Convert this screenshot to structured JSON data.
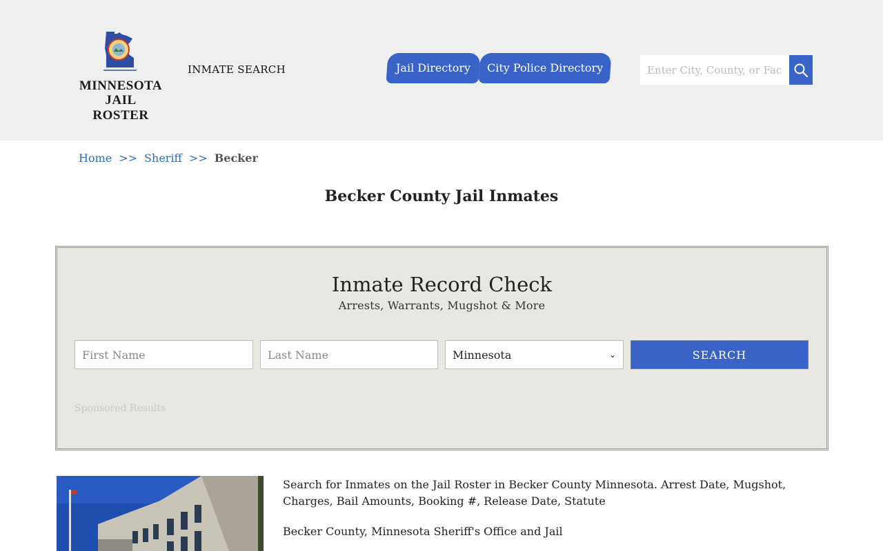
{
  "header": {
    "logo_line1": "MINNESOTA",
    "logo_line2": "JAIL ROSTER",
    "inmate_search_link": "INMATE SEARCH",
    "nav": [
      {
        "label": "Jail Directory"
      },
      {
        "label": "City Police Directory"
      }
    ],
    "search_placeholder": "Enter City, County, or Facility",
    "accent_color": "#3a63c7"
  },
  "breadcrumb": {
    "home": "Home",
    "sep": ">>",
    "sheriff": "Sheriff",
    "current": "Becker"
  },
  "page_title": "Becker County Jail Inmates",
  "record_check": {
    "title": "Inmate Record Check",
    "subtitle": "Arrests, Warrants, Mugshot & More",
    "first_name_placeholder": "First Name",
    "last_name_placeholder": "Last Name",
    "state_selected": "Minnesota",
    "search_label": "SEARCH",
    "sponsored": "Sponsored Results"
  },
  "content": {
    "desc1": "Search for Inmates on the Jail Roster in Becker County Minnesota. Arrest Date, Mugshot, Charges, Bail Amounts, Booking #, Release Date, Statute",
    "desc2": "Becker County, Minnesota Sheriff's Office and Jail"
  }
}
